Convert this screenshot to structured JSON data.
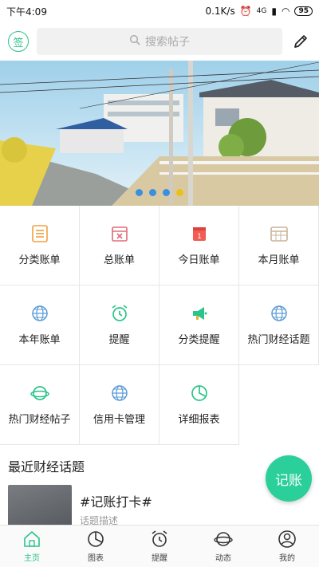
{
  "status": {
    "time": "下午4:09",
    "speed": "0.1K/s",
    "network": "4G",
    "battery": "95"
  },
  "topbar": {
    "sign_label": "签",
    "search_placeholder": "搜索帖子"
  },
  "grid": [
    {
      "label": "分类账单",
      "icon": "list-icon",
      "color": "#f0a040"
    },
    {
      "label": "总账单",
      "icon": "calendar-x-icon",
      "color": "#e06b7a"
    },
    {
      "label": "今日账单",
      "icon": "calendar-day-icon",
      "color": "#f25c54"
    },
    {
      "label": "本月账单",
      "icon": "calendar-grid-icon",
      "color": "#c9b49a"
    },
    {
      "label": "本年账单",
      "icon": "globe-icon",
      "color": "#5b9bd5"
    },
    {
      "label": "提醒",
      "icon": "alarm-icon",
      "color": "#2bc48a"
    },
    {
      "label": "分类提醒",
      "icon": "megaphone-icon",
      "color": "#2bc48a"
    },
    {
      "label": "热门财经话题",
      "icon": "globe-icon",
      "color": "#5b9bd5"
    },
    {
      "label": "热门财经帖子",
      "icon": "planet-icon",
      "color": "#2bc48a"
    },
    {
      "label": "信用卡管理",
      "icon": "globe-icon",
      "color": "#5b9bd5"
    },
    {
      "label": "详细报表",
      "icon": "pie-icon",
      "color": "#2bc48a"
    }
  ],
  "recent": {
    "title": "最近财经话题",
    "topic_title": "#记账打卡#",
    "topic_desc": "话题描述"
  },
  "fab_label": "记账",
  "tabs": [
    {
      "label": "主页",
      "icon": "home-icon",
      "active": true
    },
    {
      "label": "图表",
      "icon": "pie-icon",
      "active": false
    },
    {
      "label": "提醒",
      "icon": "alarm-icon",
      "active": false
    },
    {
      "label": "动态",
      "icon": "planet-icon",
      "active": false
    },
    {
      "label": "我的",
      "icon": "user-icon",
      "active": false
    }
  ],
  "colors": {
    "accent": "#2bc48a",
    "fab": "#2bcf9a"
  }
}
